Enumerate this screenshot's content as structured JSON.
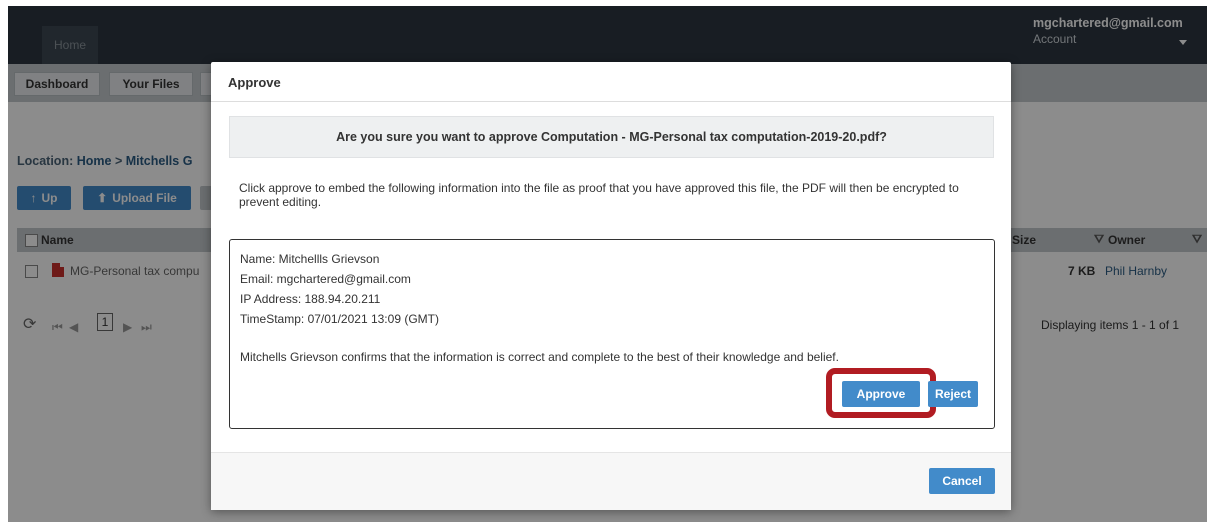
{
  "app": {
    "home_tab": "Home",
    "account_email": "mgchartered@gmail.com",
    "account_label": "Account"
  },
  "subnav": {
    "dashboard": "Dashboard",
    "your_files": "Your Files"
  },
  "location": {
    "prefix": "Location:",
    "home": "Home",
    "sep": ">",
    "folder": "Mitchells G"
  },
  "toolbar": {
    "up_label": "Up",
    "upload_label": "Upload File"
  },
  "grid": {
    "col_name": "Name",
    "col_size": "Size",
    "col_owner": "Owner",
    "rows": [
      {
        "name": "MG-Personal tax compu",
        "size": "7 KB",
        "owner": "Phil Harnby"
      }
    ],
    "page": "1",
    "pager_summary": "Displaying items 1 - 1 of 1"
  },
  "modal": {
    "title": "Approve",
    "confirm_text": "Are you sure you want to approve Computation - MG-Personal tax computation-2019-20.pdf?",
    "description": "Click approve to embed the following information into the file as proof that you have approved this file, the PDF will then be encrypted to prevent editing.",
    "info": {
      "name": "Name: Mitchellls Grievson",
      "email": "Email: mgchartered@gmail.com",
      "ip": "IP Address: 188.94.20.211",
      "timestamp": "TimeStamp: 07/01/2021 13:09 (GMT)",
      "confirmation": "Mitchells Grievson confirms that the information is correct and complete to the best of their knowledge and belief."
    },
    "approve_label": "Approve",
    "reject_label": "Reject",
    "cancel_label": "Cancel"
  },
  "colors": {
    "primary": "#428bca",
    "highlight": "#b11c22",
    "topbar": "#2c3640"
  }
}
